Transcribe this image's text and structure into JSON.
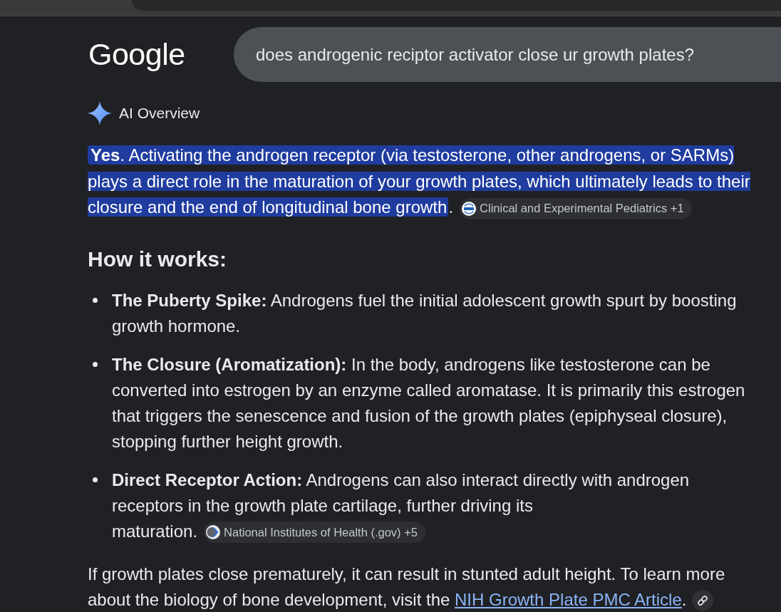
{
  "logo": "Google",
  "search": {
    "value": "does androgenic reciptor activator close ur growth plates?"
  },
  "ai_overview": {
    "title": "AI Overview",
    "answer": {
      "text": "**Yes**. Activating the androgen receptor (via testosterone, other androgens, or SARMs) plays a direct role in the maturation of your growth plates, which ultimately leads to their closure and the end of longitudinal bone growth",
      "highlighted": true,
      "trailing_text": ".",
      "citation": {
        "kind": "cep",
        "label": "Clinical and Experimental Pediatrics +1"
      }
    },
    "heading": "How it works:",
    "points": [
      {
        "text": "**The Puberty Spike:** Androgens fuel the initial adolescent growth spurt by boosting growth hormone."
      },
      {
        "text": "**The Closure (Aromatization):** In the body, androgens like testosterone can be converted into estrogen by an enzyme called aromatase. It is primarily this estrogen that triggers the senescence and fusion of the growth plates (epiphyseal closure), stopping further height growth."
      },
      {
        "text": "**Direct Receptor Action:** Androgens can also interact directly with androgen receptors in the growth plate cartilage, further driving its maturation.",
        "citation": {
          "kind": "nih",
          "label": "National Institutes of Health (.gov) +5"
        }
      }
    ],
    "closing": {
      "text": "If growth plates close prematurely, it can result in stunted adult height. To learn more about the biology of bone development, visit the",
      "link": "NIH Growth Plate PMC Article",
      "trailing_text": "."
    }
  }
}
